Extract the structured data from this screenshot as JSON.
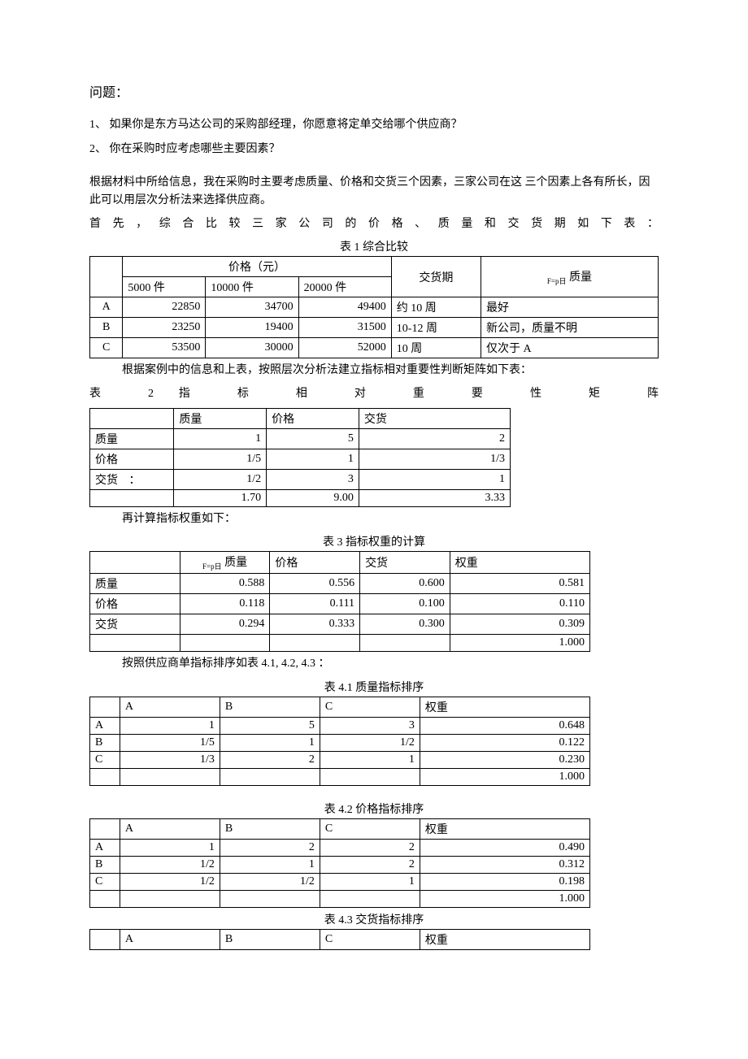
{
  "heading": "问题：",
  "q1": "1、 如果你是东方马达公司的采购部经理，你愿意将定单交给哪个供应商？",
  "q2": "2、 你在采购时应考虑哪些主要因素？",
  "intro1": "根据材料中所给信息，我在采购时主要考虑质量、价格和交货三个因素，三家公司在这 三个因素上各有所长，因此可以用层次分析法来选择供应商。",
  "intro2": "首 先 ， 综 合 比 较 三 家 公 司 的 价 格 、 质 量 和 交 货 期 如 下 表 ：",
  "t1": {
    "caption": "表 1 综合比较",
    "h_price": "价格（元）",
    "h_5000": "5000 件",
    "h_10000": "10000 件",
    "h_20000": "20000 件",
    "h_delivery": "交货期",
    "h_quality_prefix": "F=p日",
    "h_quality": " 质量",
    "rows": [
      {
        "name": "A",
        "p1": "22850",
        "p2": "34700",
        "p3": "49400",
        "d": "约 10 周",
        "q": "最好"
      },
      {
        "name": "B",
        "p1": "23250",
        "p2": "19400",
        "p3": "31500",
        "d": "10-12 周",
        "q": "新公司，质量不明"
      },
      {
        "name": "C",
        "p1": "53500",
        "p2": "30000",
        "p3": "52000",
        "d": "10 周",
        "q": "仅次于 A"
      }
    ]
  },
  "t2_intro": "根据案例中的信息和上表，按照层次分析法建立指标相对重要性判断矩阵如下表：",
  "t2_title": "表 2 指 标 相 对 重 要 性 矩 阵",
  "t2": {
    "cols": [
      "",
      "质量",
      "价格",
      "交货"
    ],
    "rows": [
      {
        "label": "质量",
        "v": [
          "1",
          "5",
          "2"
        ]
      },
      {
        "label": "价格",
        "v": [
          "1/5",
          "1",
          "1/3"
        ]
      },
      {
        "label": "交货",
        "v": [
          "1/2",
          "3",
          "1"
        ]
      }
    ],
    "sum": [
      "1.70",
      "9.00",
      "3.33"
    ]
  },
  "t3_intro": "再计算指标权重如下：",
  "t3": {
    "caption": "表 3 指标权重的计算",
    "h_quality_prefix": "F=p日",
    "h_quality": " 质量",
    "cols": [
      "价格",
      "交货",
      "权重"
    ],
    "rows": [
      {
        "label": "质量",
        "v": [
          "0.588",
          "0.556",
          "0.600",
          "0.581"
        ]
      },
      {
        "label": "价格",
        "v": [
          "0.118",
          "0.111",
          "0.100",
          "0.110"
        ]
      },
      {
        "label": "交货",
        "v": [
          "0.294",
          "0.333",
          "0.300",
          "0.309"
        ]
      }
    ],
    "total": "1.000"
  },
  "t4_intro": "按照供应商单指标排序如表    4.1, 4.2, 4.3 ：",
  "t41": {
    "caption": "表 4.1 质量指标排序",
    "cols": [
      "",
      "A",
      "B",
      "C",
      "权重"
    ],
    "rows": [
      {
        "label": "A",
        "v": [
          "1",
          "5",
          "3",
          "0.648"
        ]
      },
      {
        "label": "B",
        "v": [
          "1/5",
          "1",
          "1/2",
          "0.122"
        ]
      },
      {
        "label": "C",
        "v": [
          "1/3",
          "2",
          "1",
          "0.230"
        ]
      }
    ],
    "total": "1.000"
  },
  "t42": {
    "caption": "表 4.2 价格指标排序",
    "cols": [
      "",
      "A",
      "B",
      "C",
      "权重"
    ],
    "rows": [
      {
        "label": "A",
        "v": [
          "1",
          "2",
          "2",
          "0.490"
        ]
      },
      {
        "label": "B",
        "v": [
          "1/2",
          "1",
          "2",
          "0.312"
        ]
      },
      {
        "label": "C",
        "v": [
          "1/2",
          "1/2",
          "1",
          "0.198"
        ]
      }
    ],
    "total": "1.000"
  },
  "t43": {
    "caption": "表 4.3 交货指标排序",
    "cols": [
      "",
      "A",
      "B",
      "C",
      "权重"
    ]
  }
}
